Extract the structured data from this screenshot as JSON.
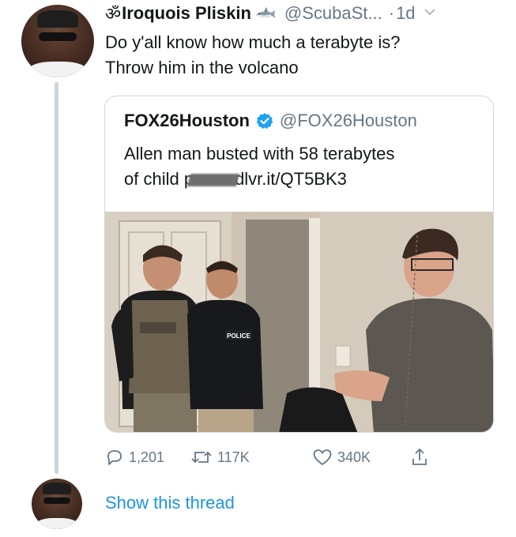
{
  "tweet": {
    "display_name": "Iroquois Pliskin",
    "name_prefix_icon": "om-symbol",
    "name_suffix_icon": "shark-emoji",
    "handle": "@ScubaSt...",
    "separator": "·",
    "time": "1d",
    "menu_icon": "chevron-down-icon",
    "text_lines": [
      "Do y'all know how much a terabyte is?",
      "Throw him in the volcano"
    ]
  },
  "quoted_tweet": {
    "display_name": "FOX26Houston",
    "verified_icon": "verified-badge-icon",
    "handle": "@FOX26Houston",
    "text_line1": "Allen man busted with 58 terabytes",
    "text_line2_before": "of child p",
    "text_line2_after": "dlvr.it/QT5BK3",
    "image_description_icon": "photo-police-arrest"
  },
  "actions": {
    "reply_count": "1,201",
    "retweet_count": "117K",
    "like_count": "340K",
    "reply_icon": "reply-icon",
    "retweet_icon": "retweet-icon",
    "like_icon": "heart-icon",
    "share_icon": "share-icon"
  },
  "thread": {
    "show_thread_label": "Show this thread"
  },
  "colors": {
    "link": "#1b95e0",
    "secondary_text": "#657786",
    "verified": "#1da1f2",
    "thread_line": "#ccd6dd",
    "border": "#d0d8de"
  }
}
